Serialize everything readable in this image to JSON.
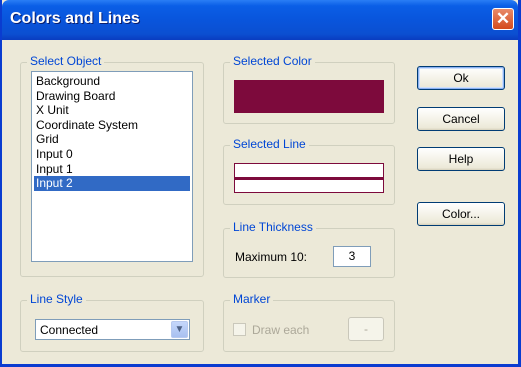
{
  "window": {
    "title": "Colors and Lines",
    "close_glyph": "✕"
  },
  "select_object": {
    "legend": "Select Object",
    "items": [
      "Background",
      "Drawing Board",
      "X Unit",
      "Coordinate System",
      "Grid",
      "Input  0",
      "Input  1",
      "Input  2"
    ],
    "selected_index": 7
  },
  "selected_color": {
    "legend": "Selected Color",
    "color": "#7d0a3c"
  },
  "selected_line": {
    "legend": "Selected Line",
    "color": "#7d0a3c"
  },
  "line_thickness": {
    "legend": "Line Thickness",
    "label": "Maximum 10:",
    "value": "3"
  },
  "line_style": {
    "legend": "Line Style",
    "value": "Connected"
  },
  "marker": {
    "legend": "Marker",
    "checkbox_label": "Draw each",
    "button_label": "-",
    "checked": false
  },
  "buttons": {
    "ok": "Ok",
    "cancel": "Cancel",
    "help": "Help",
    "color": "Color..."
  },
  "colors": {
    "title_bar": "#0955dc",
    "face": "#ece9d8",
    "legend_text": "#0046d5",
    "selection": "#316ac5"
  }
}
